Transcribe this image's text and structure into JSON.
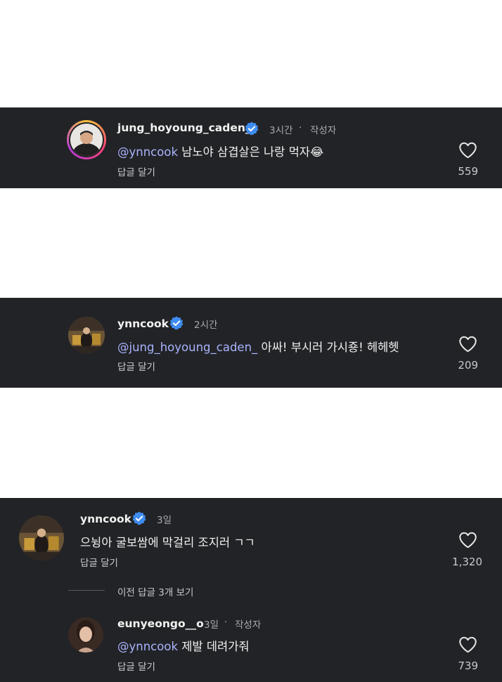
{
  "comments": [
    {
      "username": "jung_hoyoung_caden_",
      "time": "3시간",
      "separator": "·",
      "author_badge": "작성자",
      "mention": "@ynncook",
      "text": " 남노야 삼겹살은 나랑 먹자😂",
      "reply_label": "답글 달기",
      "likes": "559"
    },
    {
      "username": "ynncook",
      "time": "2시간",
      "mention": "@jung_hoyoung_caden_",
      "text": " 아싸! 부시러 가시죵! 헤헤헷",
      "reply_label": "답글 달기",
      "likes": "209"
    },
    {
      "username": "ynncook",
      "time": "3일",
      "text": "으뉭아 굴보쌈에 막걸리 조지러 ㄱㄱ",
      "reply_label": "답글 달기",
      "likes": "1,320",
      "view_replies": "이전 답글 3개 보기",
      "reply": {
        "username": "eunyeongo__o",
        "time": "3일",
        "separator": "·",
        "author_badge": "작성자",
        "mention": "@ynncook",
        "text": " 제발 데려가줘",
        "reply_label": "답글 달기",
        "likes": "739"
      }
    }
  ],
  "colors": {
    "panel_bg": "#222326",
    "mention": "#a9b4ff",
    "verified": "#3f8cf0"
  }
}
